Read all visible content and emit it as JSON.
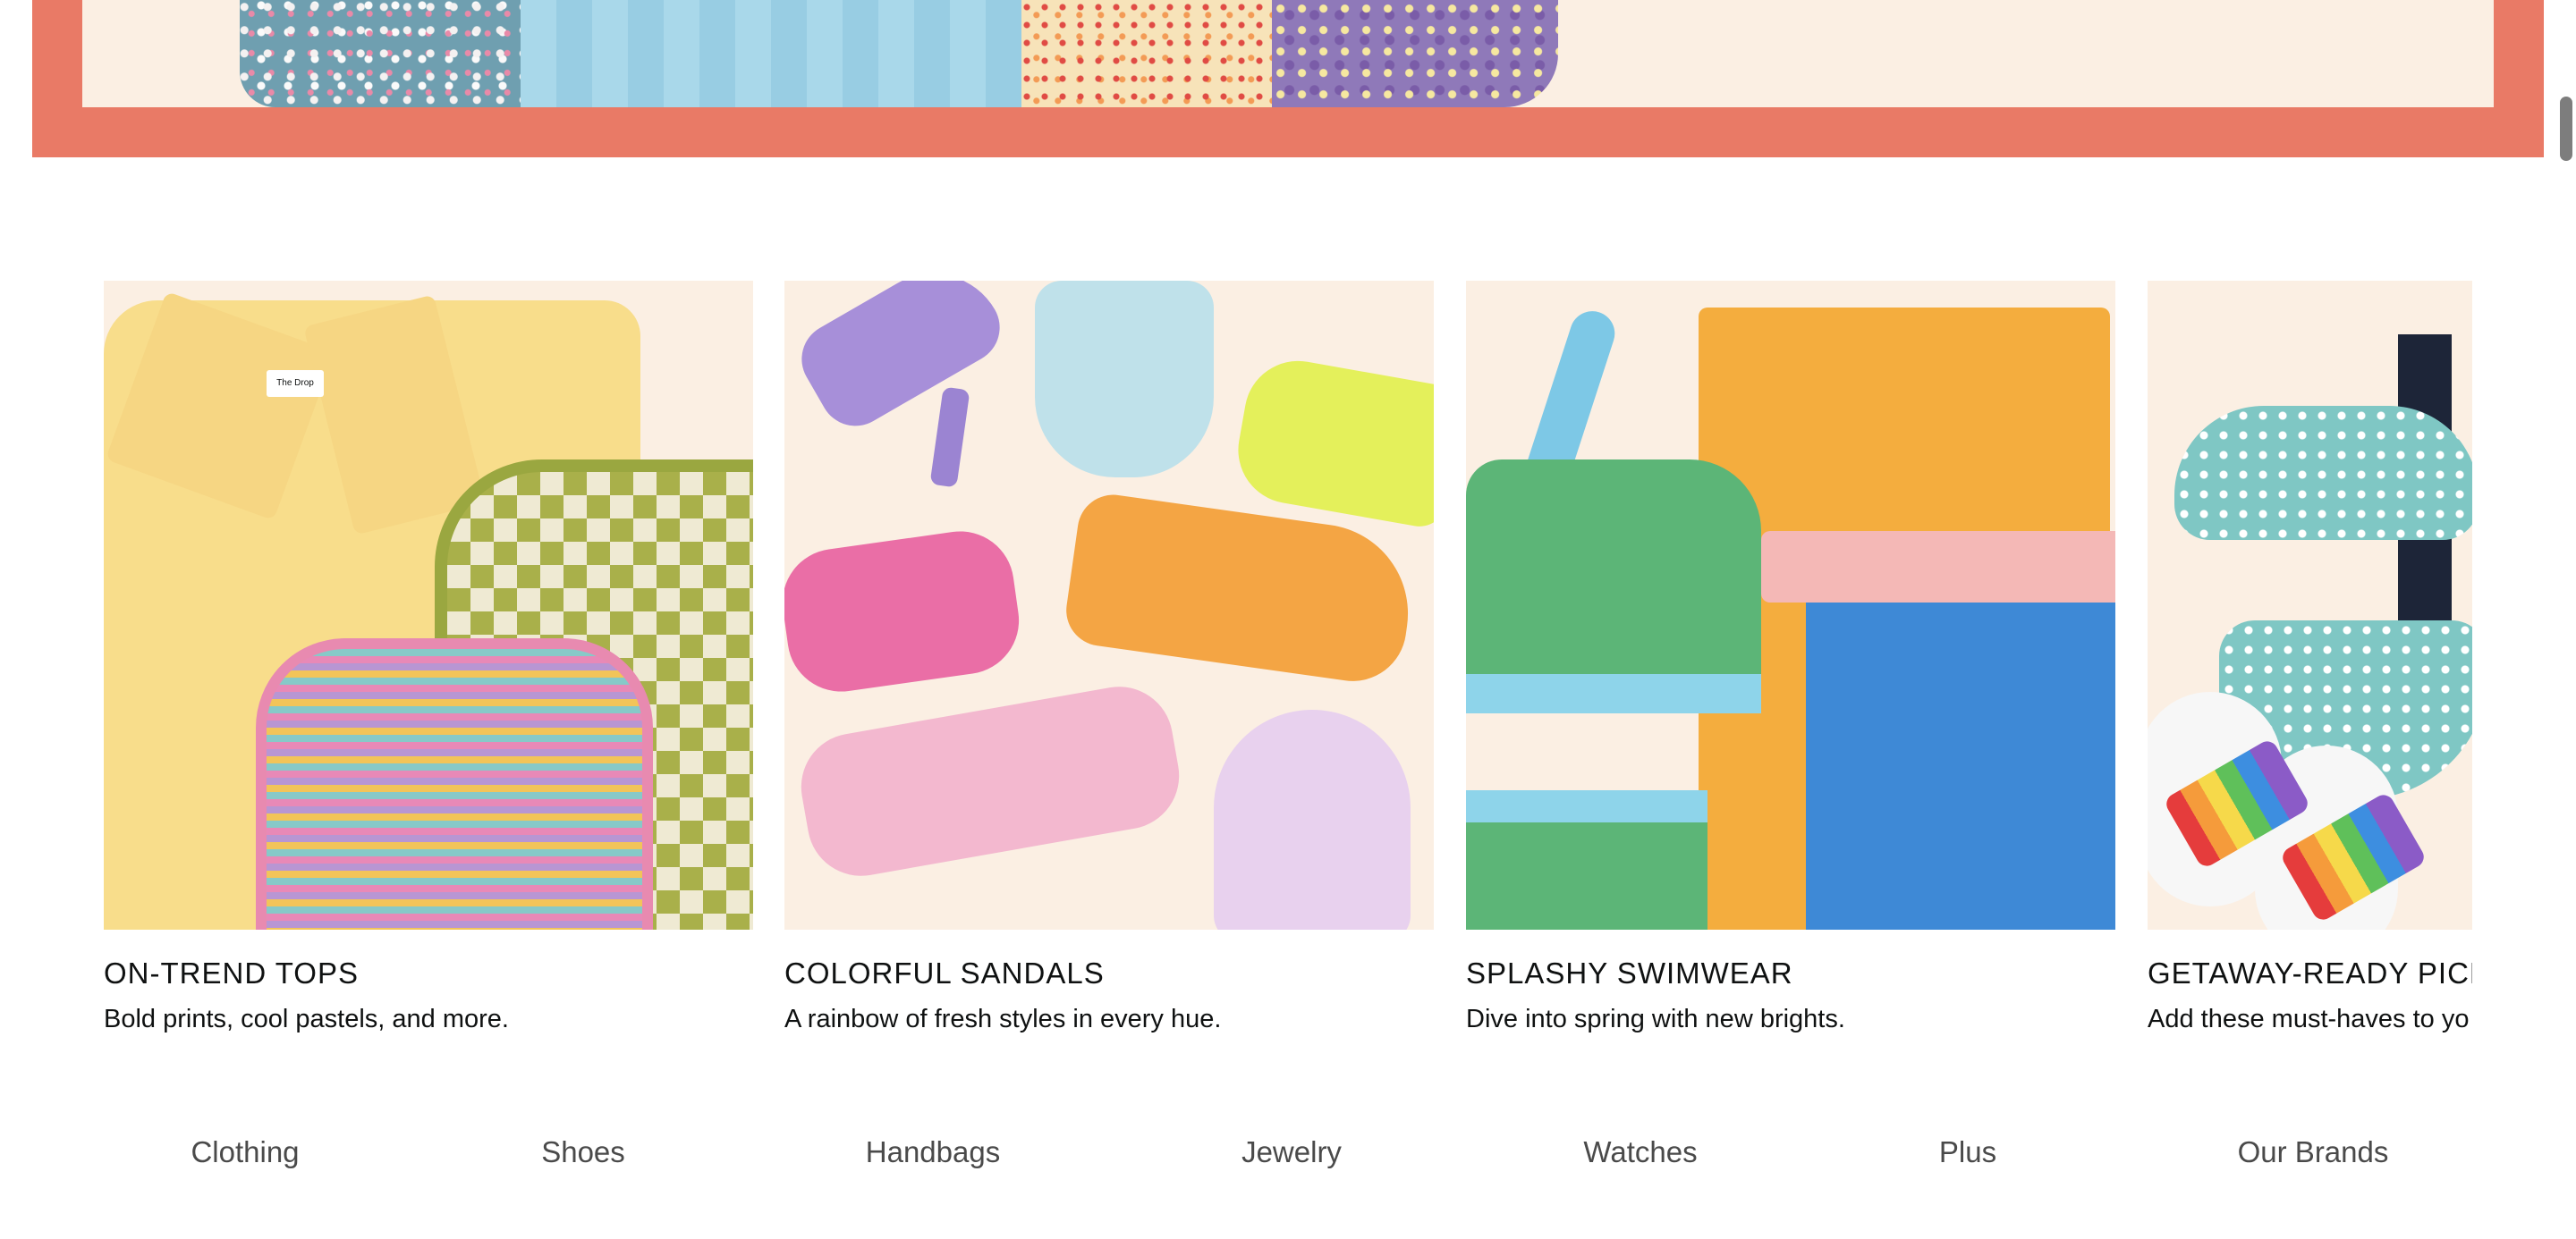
{
  "cards": [
    {
      "title": "ON-TREND TOPS",
      "subtitle": "Bold prints, cool pastels, and more."
    },
    {
      "title": "COLORFUL SANDALS",
      "subtitle": "A rainbow of fresh styles in every hue."
    },
    {
      "title": "SPLASHY SWIMWEAR",
      "subtitle": "Dive into spring with new brights."
    },
    {
      "title": "GETAWAY-READY PICKS",
      "subtitle": "Add these must-haves to yo"
    }
  ],
  "tops_tag": "The Drop",
  "bottom_nav": {
    "items": [
      "Clothing",
      "Shoes",
      "Handbags",
      "Jewelry",
      "Watches",
      "Plus",
      "Our Brands"
    ]
  },
  "colors": {
    "hero_frame": "#e97a66",
    "hero_background": "#fbefe3",
    "card_background": "#fbefe3",
    "nav_text": "#4a4a4a"
  }
}
